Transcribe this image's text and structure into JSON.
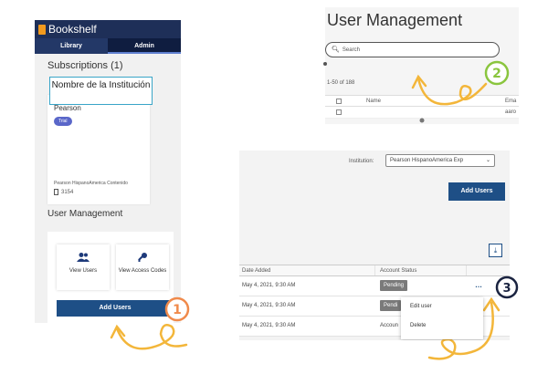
{
  "bookshelf": {
    "app_title": "Bookshelf",
    "tabs": [
      "Library",
      "Admin"
    ],
    "subscriptions_title": "Subscriptions (1)",
    "institution_annotation": "Nombre de la Institución",
    "card": {
      "title": "Pearson",
      "badge": "Trial",
      "description": "Pearson HispanoAmerica Contenido",
      "count": "3154"
    },
    "user_management_title": "User Management",
    "tiles": [
      {
        "icon": "users-icon",
        "label": "View Users"
      },
      {
        "icon": "key-icon",
        "label": "View Access Codes"
      }
    ],
    "add_users_label": "Add Users"
  },
  "user_list": {
    "title": "User Management",
    "search_placeholder": "Search",
    "result_count": "1-50 of 188",
    "columns": {
      "name": "Name",
      "email": "Ema"
    },
    "rows": [
      {
        "name": "",
        "email": "aaro"
      }
    ]
  },
  "accounts": {
    "institution_label": "Institution:",
    "institution_value": "Pearson HispanoAmerica Exp",
    "add_users_label": "Add Users",
    "columns": {
      "date": "Date Added",
      "status": "Account Status"
    },
    "rows": [
      {
        "date": "May 4, 2021, 9:30 AM",
        "status": "Pending"
      },
      {
        "date": "May 4, 2021, 9:30 AM",
        "status": "Pendi"
      },
      {
        "date": "May 4, 2021, 9:30 AM",
        "status": "Accoun"
      }
    ],
    "menu": [
      "Edit user",
      "Delete"
    ]
  },
  "steps": [
    "1",
    "2",
    "3"
  ],
  "colors": {
    "navy": "#1e2f58",
    "button_blue": "#1e4f86",
    "arrow_yellow": "#f3b63a",
    "step1": "#f08a4b",
    "step2": "#8ac53e",
    "step3": "#1a2340"
  }
}
